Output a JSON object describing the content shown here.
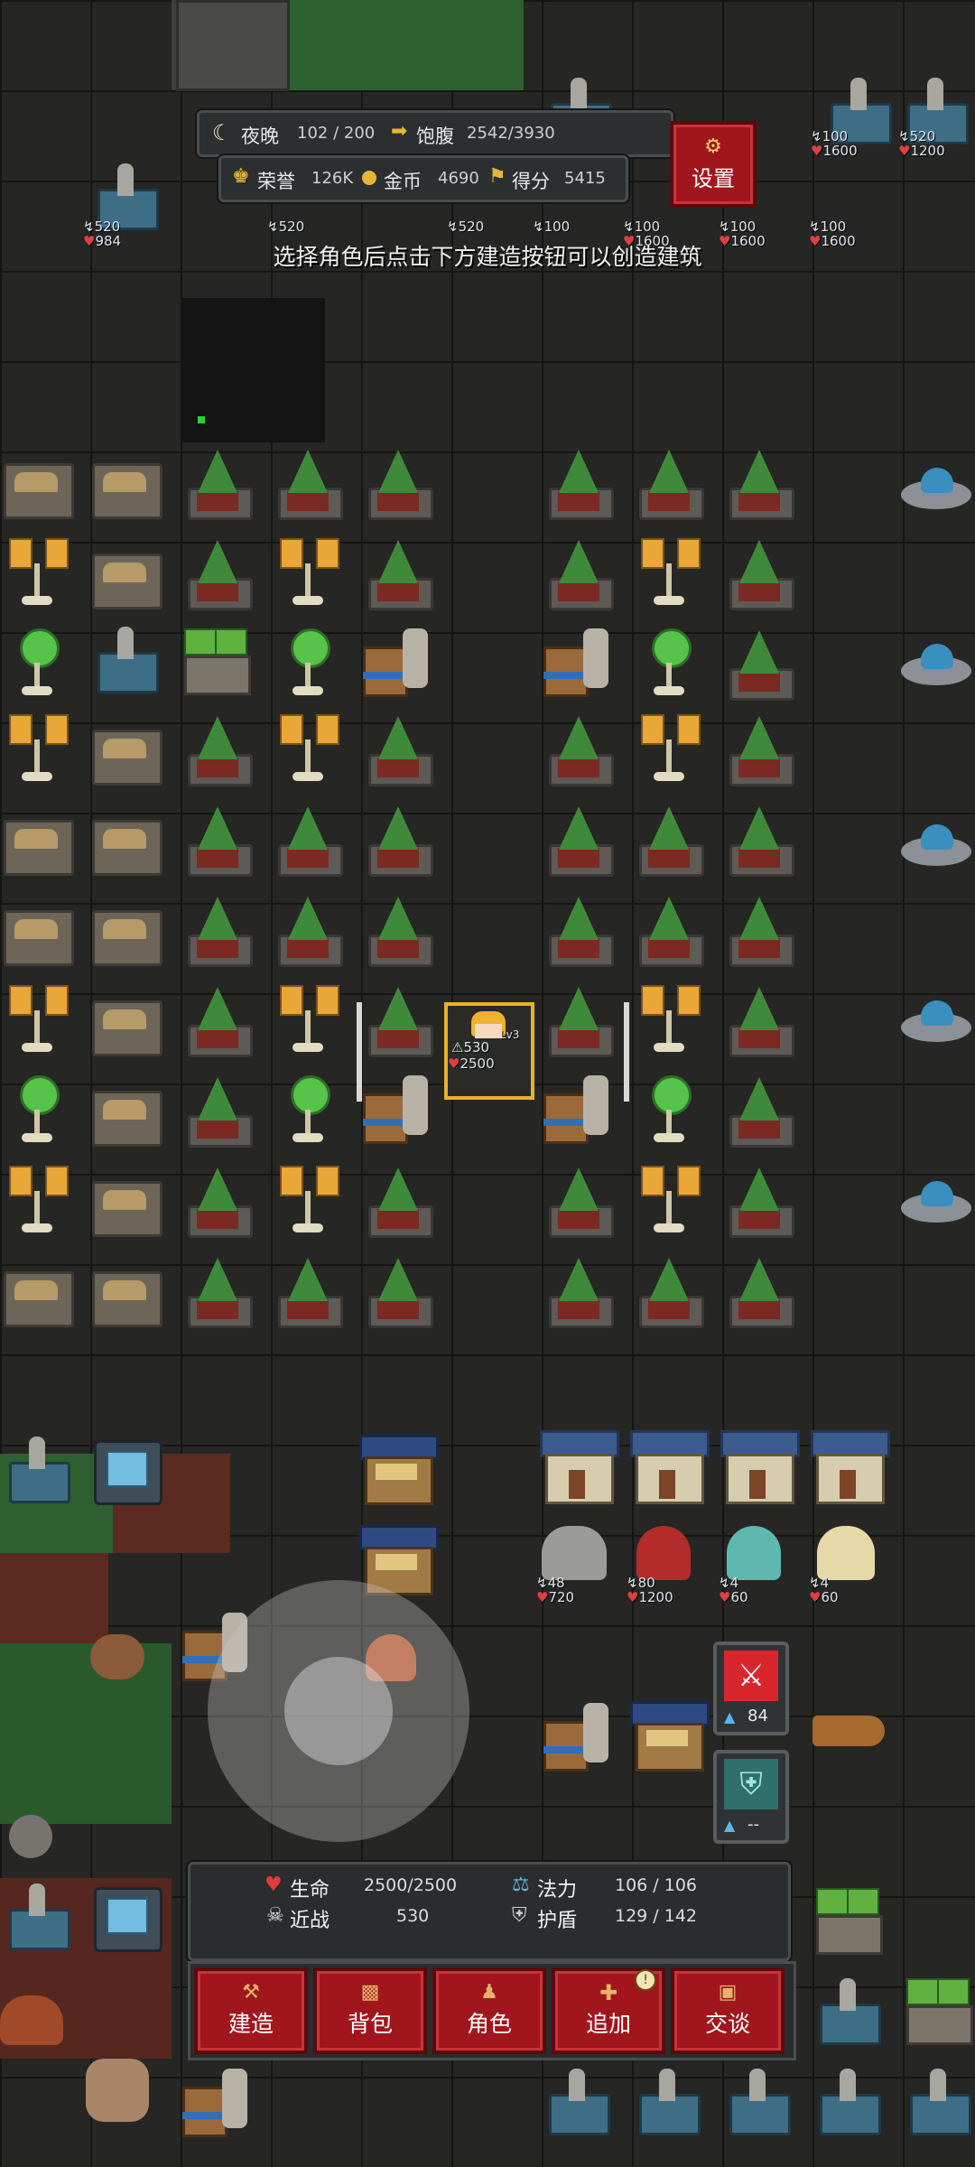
{
  "hud": {
    "night_label": "夜晚",
    "night_value": "102 / 200",
    "satiety_label": "饱腹",
    "satiety_value": "2542/3930",
    "honor_label": "荣誉",
    "honor_value": "126K",
    "gold_label": "金币",
    "gold_value": "4690",
    "score_label": "得分",
    "score_value": "5415",
    "settings_label": "设置",
    "hint": "选择角色后点击下方建造按钮可以创造建筑"
  },
  "map_stats": {
    "top_left": {
      "atk": "520",
      "hp": "984"
    },
    "top_row": [
      {
        "atk": "520",
        "hp": ""
      },
      {
        "atk": "520",
        "hp": ""
      },
      {
        "atk": "100",
        "hp": ""
      },
      {
        "atk": "100",
        "hp": "1600"
      },
      {
        "atk": "100",
        "hp": "1600"
      },
      {
        "atk": "100",
        "hp": "1600"
      },
      {
        "atk": "100",
        "hp": "1600"
      },
      {
        "atk": "520",
        "hp": "1200"
      }
    ],
    "hero": {
      "atk": "530",
      "hp": "2500",
      "level": "Lv3"
    },
    "units": [
      {
        "atk": "48",
        "hp": "720"
      },
      {
        "atk": "80",
        "hp": "1200"
      },
      {
        "atk": "4",
        "hp": "60"
      },
      {
        "atk": "4",
        "hp": "60"
      }
    ]
  },
  "skills": [
    {
      "icon": "sword-icon",
      "value": "84",
      "color": "#d8262c"
    },
    {
      "icon": "shield-icon",
      "value": "--",
      "color": "#4fa3a5"
    }
  ],
  "stats_panel": {
    "hp_label": "生命",
    "hp_value": "2500/2500",
    "mp_label": "法力",
    "mp_value": "106 / 106",
    "melee_label": "近战",
    "melee_value": "530",
    "shield_label": "护盾",
    "shield_value": "129 / 142"
  },
  "actions": [
    {
      "label": "建造",
      "icon": "hammer-icon"
    },
    {
      "label": "背包",
      "icon": "bag-icon"
    },
    {
      "label": "角色",
      "icon": "character-icon"
    },
    {
      "label": "追加",
      "icon": "plus-icon",
      "badge": "!"
    },
    {
      "label": "交谈",
      "icon": "chat-icon"
    }
  ],
  "colors": {
    "button_red": "#a1161c",
    "grass": "#2f6a2f",
    "soil": "#6a2e22",
    "honor_gold": "#e6b53a",
    "selection": "#e8b22a"
  }
}
